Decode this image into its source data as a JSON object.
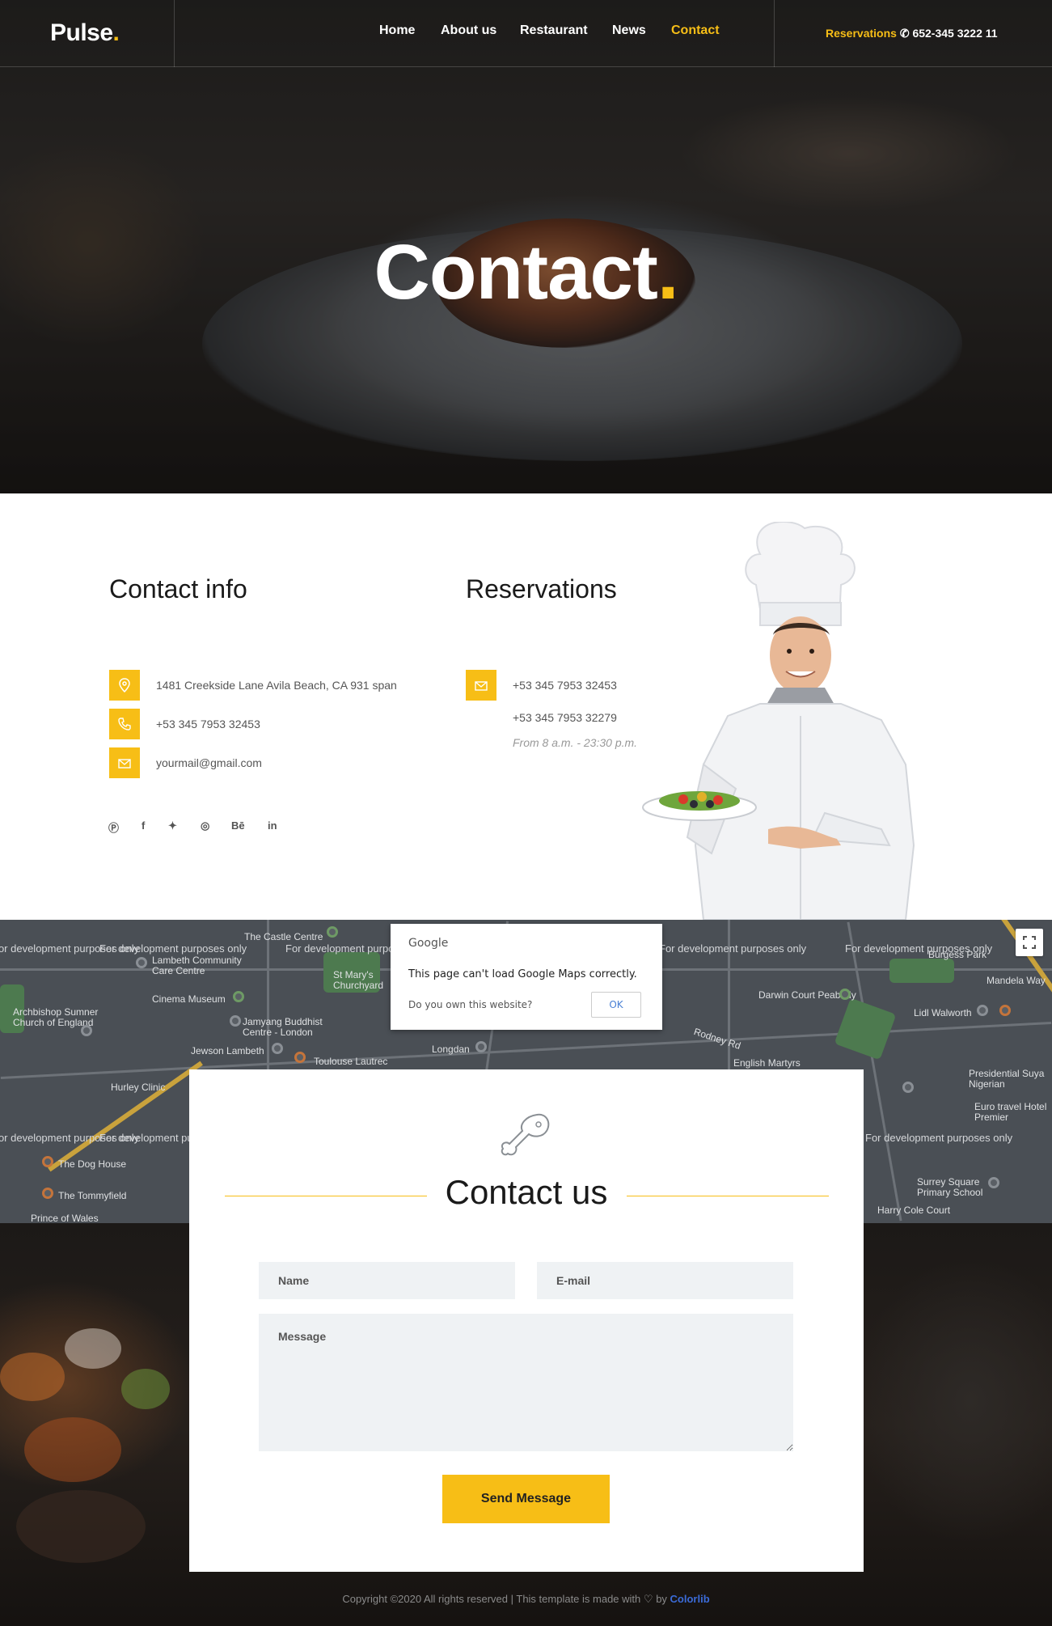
{
  "header": {
    "logo_text": "Pulse",
    "logo_dot": ".",
    "nav": [
      {
        "label": "Home",
        "active": false
      },
      {
        "label": "About us",
        "active": false
      },
      {
        "label": "Restaurant",
        "active": false
      },
      {
        "label": "News",
        "active": false
      },
      {
        "label": "Contact",
        "active": true
      }
    ],
    "reservations_label": "Reservations",
    "reservations_phone": "652-345 3222 11"
  },
  "hero": {
    "title": "Contact",
    "title_dot": "."
  },
  "contact_info": {
    "heading": "Contact info",
    "address": "1481 Creekside Lane Avila Beach, CA 931 span",
    "phone": "+53 345 7953 32453",
    "email": "yourmail@gmail.com",
    "socials": [
      "pinterest-icon",
      "facebook-icon",
      "twitter-icon",
      "dribbble-icon",
      "behance-icon",
      "linkedin-icon"
    ]
  },
  "reservations": {
    "heading": "Reservations",
    "phone1": "+53 345 7953 32453",
    "phone2": "+53 345 7953 32279",
    "hours": "From 8 a.m. - 23:30 p.m."
  },
  "map": {
    "watermark": "For development purposes only",
    "places": [
      "The Castle Centre",
      "Lambeth Community Care Centre",
      "St Mary's Churchyard",
      "Cinema Museum",
      "Archbishop Sumner Church of England",
      "Jamyang Buddhist Centre - London",
      "Toulouse Lautrec",
      "Jewson Lambeth",
      "Hurley Clinic",
      "The Dog House",
      "The Tommyfield",
      "Prince of Wales",
      "Longdan",
      "Rodney Rd",
      "English Martyrs",
      "Darwin Court Peabody",
      "Lidl Walworth",
      "Presidential Suya Nigerian",
      "Surrey Square Primary School",
      "Harry Cole Court",
      "Mandela Way",
      "Euro travel Hotel Premier",
      "Burgess Park"
    ],
    "dialog": {
      "brand": "Google",
      "message": "This page can't load Google Maps correctly.",
      "question": "Do you own this website?",
      "ok_label": "OK"
    }
  },
  "contact_form": {
    "heading": "Contact us",
    "name_placeholder": "Name",
    "email_placeholder": "E-mail",
    "message_placeholder": "Message",
    "send_label": "Send Message"
  },
  "footer": {
    "copy_prefix": "Copyright ©2020 All rights reserved | This template is made with",
    "by": "by",
    "brand": "Colorlib"
  },
  "colors": {
    "accent": "#f7be16",
    "field_bg": "#eff2f4",
    "link": "#3b6bd8"
  }
}
